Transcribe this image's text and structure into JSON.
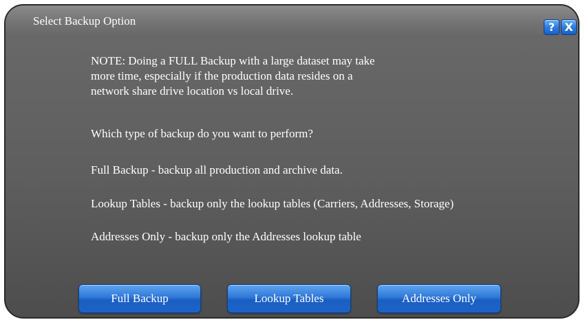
{
  "dialog": {
    "title": "Select Backup Option",
    "help_icon": "question-mark-icon",
    "close_icon": "close-icon",
    "help_glyph": "?",
    "close_glyph": "X"
  },
  "message": {
    "note_lines": [
      "NOTE: Doing a FULL Backup with a large dataset may take",
      "more time, especially if the production data resides on a",
      "network share drive location vs local drive."
    ],
    "question": "Which type of backup do you want to perform?",
    "full_desc": "Full Backup - backup all production and archive data.",
    "lookup_desc": "Lookup Tables - backup only the lookup tables (Carriers, Addresses, Storage)",
    "addresses_desc": "Addresses Only - backup only the Addresses lookup table"
  },
  "buttons": {
    "full_label": "Full Backup",
    "lookup_label": "Lookup Tables",
    "addresses_label": "Addresses Only"
  },
  "colors": {
    "button_blue": "#2f78d8",
    "panel_gray": "#5e5e5e",
    "text": "#ffffff"
  }
}
